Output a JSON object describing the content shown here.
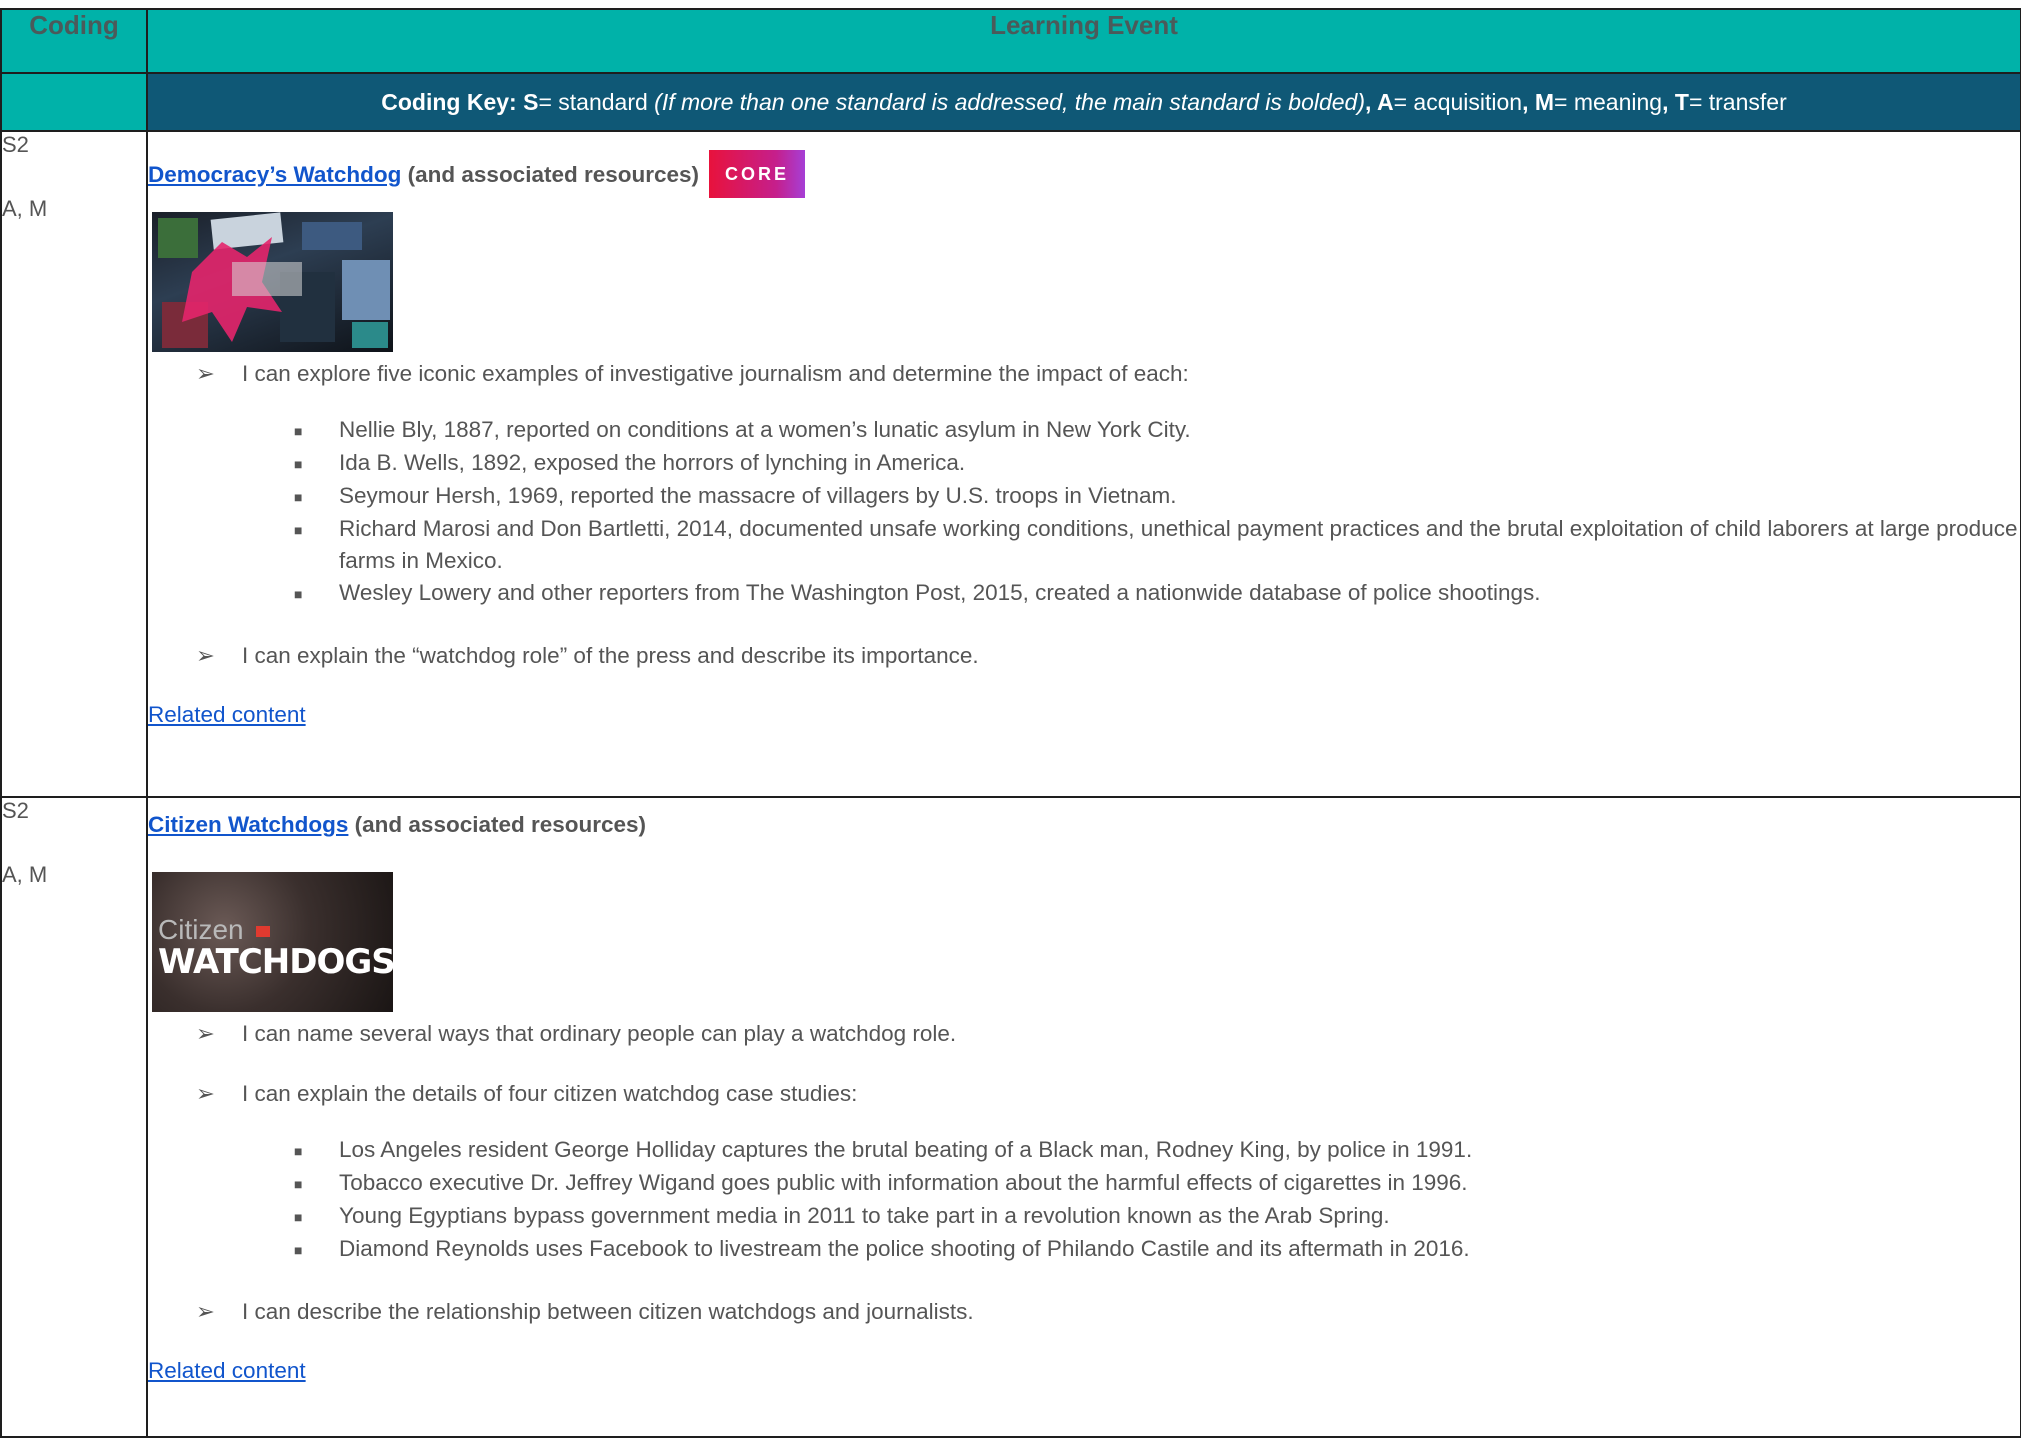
{
  "header": {
    "coding_label": "Coding",
    "event_label": "Learning Event",
    "key": {
      "prefix": "Coding Key: ",
      "s": "S",
      "s_def": "= standard ",
      "s_note": "(If more than one standard is addressed, the main standard is bolded)",
      "sep1": ", ",
      "a": "A",
      "a_def": "= acquisition",
      "sep2": ", ",
      "m": "M",
      "m_def": "= meaning",
      "sep3": ", ",
      "t": "T",
      "t_def": "= transfer"
    }
  },
  "rows": [
    {
      "coding": [
        "S2",
        "A, M"
      ],
      "title_link": "Democracy’s Watchdog",
      "title_rest": " (and associated resources)",
      "badge": "CORE",
      "thumbnail_icon": "investigative-collage-image",
      "objective1": "I can explore five iconic examples of investigative journalism and determine the impact of each:",
      "examples": [
        "Nellie Bly, 1887, reported on conditions at a women’s lunatic asylum in New York City.",
        "Ida B. Wells, 1892, exposed the horrors of lynching in America.",
        "Seymour Hersh, 1969, reported the massacre of villagers by U.S. troops in Vietnam.",
        "Richard Marosi and Don Bartletti, 2014, documented unsafe working conditions, unethical payment practices and the brutal exploitation of child laborers at large produce farms in Mexico.",
        "Wesley Lowery and other reporters from The Washington Post, 2015, created a nationwide database of police shootings."
      ],
      "objective2": "I can explain the “watchdog role” of the press and describe its importance.",
      "related": "Related content"
    },
    {
      "coding": [
        "S2",
        "A, M"
      ],
      "title_link": "Citizen Watchdogs",
      "title_rest": " (and associated resources)",
      "thumbnail_text_top": "Citizen",
      "thumbnail_text_bottom": "WATCHDOGS",
      "objective1": "I can name several ways that ordinary people can play a watchdog role.",
      "objective2": "I can explain the details of four citizen watchdog case studies:",
      "examples": [
        "Los Angeles resident George Holliday captures the brutal beating of a Black man, Rodney King, by police in 1991.",
        "Tobacco executive Dr. Jeffrey Wigand goes public with information about the harmful effects of cigarettes in 1996.",
        "Young Egyptians bypass government media in 2011 to take part in a revolution known as the Arab Spring.",
        "Diamond Reynolds uses Facebook to livestream the police shooting of Philando Castile and its aftermath in 2016."
      ],
      "objective3": "I can describe the relationship between citizen watchdogs and journalists.",
      "related": "Related content"
    }
  ],
  "colors": {
    "teal": "#00b2a9",
    "navy": "#0f5876",
    "link": "#1155cc"
  },
  "icons": {
    "bullet_arrow": "➢",
    "bullet_square": "■"
  }
}
